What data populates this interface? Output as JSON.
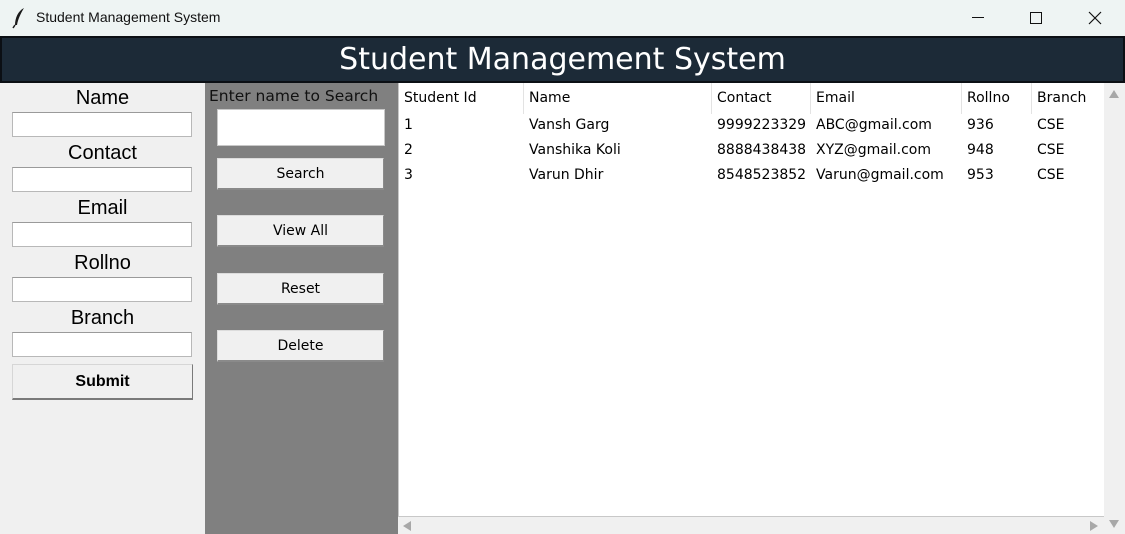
{
  "window": {
    "title": "Student Management System",
    "icon": "feather-icon"
  },
  "banner": {
    "title": "Student Management System"
  },
  "form": {
    "fields": [
      {
        "label": "Name",
        "value": ""
      },
      {
        "label": "Contact",
        "value": ""
      },
      {
        "label": "Email",
        "value": ""
      },
      {
        "label": "Rollno",
        "value": ""
      },
      {
        "label": "Branch",
        "value": ""
      }
    ],
    "submit_label": "Submit"
  },
  "search": {
    "label": "Enter name to Search",
    "value": "",
    "search_label": "Search",
    "view_all_label": "View All",
    "reset_label": "Reset",
    "delete_label": "Delete"
  },
  "table": {
    "columns": [
      "Student Id",
      "Name",
      "Contact",
      "Email",
      "Rollno",
      "Branch"
    ],
    "rows": [
      [
        "1",
        "Vansh Garg",
        "9999223329",
        "ABC@gmail.com",
        "936",
        "CSE"
      ],
      [
        "2",
        "Vanshika Koli",
        "8888438438",
        "XYZ@gmail.com",
        "948",
        "CSE"
      ],
      [
        "3",
        "Varun Dhir",
        "8548523852",
        "Varun@gmail.com",
        "953",
        "CSE"
      ]
    ]
  },
  "colors": {
    "banner_bg": "#1c2a37",
    "search_panel_bg": "#808080",
    "window_bg": "#f0f0f0"
  }
}
